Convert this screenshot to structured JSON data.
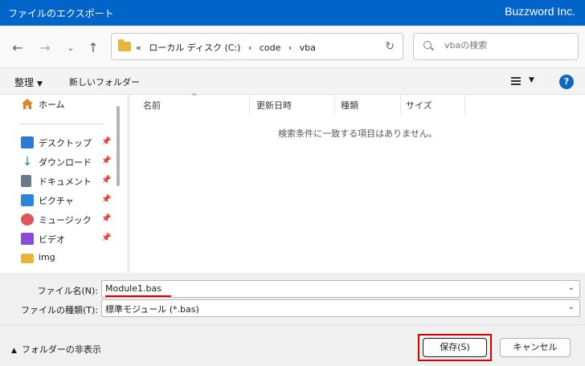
{
  "window": {
    "title": "ファイルのエクスポート",
    "brand": "Buzzword Inc."
  },
  "nav": {
    "back_icon": "arrow-left-icon",
    "forward_icon": "arrow-right-icon",
    "recent_icon": "chevron-down-icon",
    "up_icon": "arrow-up-icon",
    "address": {
      "prefix": "«",
      "crumbs": [
        "ローカル ディスク (C:)",
        "code",
        "vba"
      ],
      "separator": "›"
    },
    "search_placeholder": "vbaの検索"
  },
  "toolbar": {
    "organize": "整理",
    "new_folder": "新しいフォルダー",
    "help": "?"
  },
  "sidebar": {
    "home": "ホーム",
    "items": [
      {
        "label": "デスクトップ",
        "pinned": true,
        "icon": "desktop-icon",
        "color": "#2b7bd6"
      },
      {
        "label": "ダウンロード",
        "pinned": true,
        "icon": "download-icon",
        "color": "#1f9a5a"
      },
      {
        "label": "ドキュメント",
        "pinned": true,
        "icon": "document-icon",
        "color": "#6c7a89"
      },
      {
        "label": "ピクチャ",
        "pinned": true,
        "icon": "picture-icon",
        "color": "#2f86d8"
      },
      {
        "label": "ミュージック",
        "pinned": true,
        "icon": "music-icon",
        "color": "#e0565b"
      },
      {
        "label": "ビデオ",
        "pinned": true,
        "icon": "video-icon",
        "color": "#8a4bd6"
      },
      {
        "label": "img",
        "pinned": false,
        "icon": "folder-icon",
        "color": "#e8b53b"
      }
    ]
  },
  "filelist": {
    "columns": [
      "名前",
      "更新日時",
      "種類",
      "サイズ"
    ],
    "empty_message": "検索条件に一致する項目はありません。"
  },
  "form": {
    "filename_label": "ファイル名(N):",
    "filename_value": "Module1.bas",
    "filetype_label": "ファイルの種類(T):",
    "filetype_value": "標準モジュール (*.bas)"
  },
  "footer": {
    "hide_folders": "フォルダーの非表示",
    "save": "保存(S)",
    "cancel": "キャンセル"
  },
  "colors": {
    "titlebar": "#0064c8",
    "highlight": "#d40000"
  }
}
